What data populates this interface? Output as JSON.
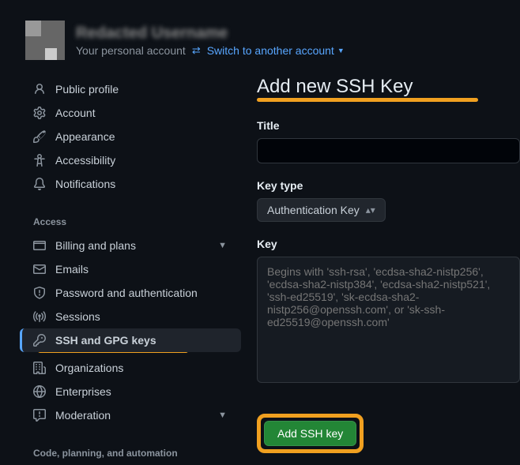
{
  "header": {
    "username": "Redacted Username",
    "subtitle": "Your personal account",
    "switch_label": "Switch to another account"
  },
  "sidebar": {
    "items": {
      "public_profile": "Public profile",
      "account": "Account",
      "appearance": "Appearance",
      "accessibility": "Accessibility",
      "notifications": "Notifications"
    },
    "access_title": "Access",
    "access": {
      "billing": "Billing and plans",
      "emails": "Emails",
      "password_auth": "Password and authentication",
      "sessions": "Sessions",
      "ssh_gpg": "SSH and GPG keys",
      "organizations": "Organizations",
      "enterprises": "Enterprises",
      "moderation": "Moderation"
    },
    "code_title": "Code, planning, and automation"
  },
  "main": {
    "title": "Add new SSH Key",
    "title_label": "Title",
    "keytype_label": "Key type",
    "keytype_value": "Authentication Key",
    "key_label": "Key",
    "key_placeholder": "Begins with 'ssh-rsa', 'ecdsa-sha2-nistp256', 'ecdsa-sha2-nistp384', 'ecdsa-sha2-nistp521', 'ssh-ed25519', 'sk-ecdsa-sha2-nistp256@openssh.com', or 'sk-ssh-ed25519@openssh.com'",
    "submit_label": "Add SSH key"
  }
}
